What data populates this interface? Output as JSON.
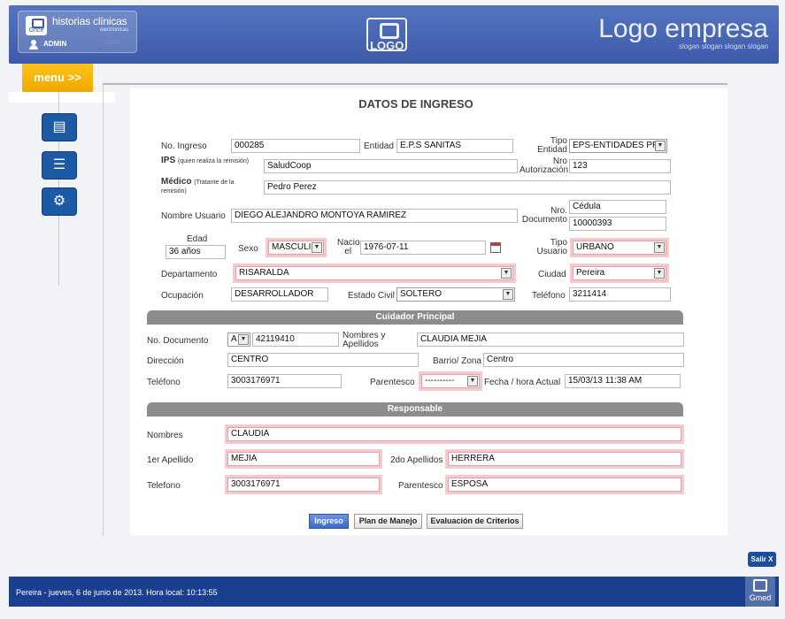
{
  "header": {
    "app_name": "historias clínicas",
    "app_subtitle": "electrónicas",
    "app_logo_text": "Ghce",
    "user_name": "ADMIN",
    "dots": "::::::",
    "brand_logo_text": "LOGO",
    "brand_name": "Logo empresa",
    "brand_slogan": "slogan slogan slogan slogan"
  },
  "menu": {
    "label": "menu >>",
    "icons": [
      "documents-icon",
      "clipboard-icon",
      "gear-icon"
    ]
  },
  "form": {
    "title": "DATOS DE INGRESO",
    "no_ingreso_label": "No. Ingreso",
    "no_ingreso": "000285",
    "entidad_label": "Entidad",
    "entidad": "E.P.S SANITAS",
    "tipo_entidad_label_1": "Tipo",
    "tipo_entidad_label_2": "Entidad",
    "tipo_entidad": "EPS-ENTIDADES PR",
    "ips_label": "IPS",
    "ips_note": "(quien realiza la remisión)",
    "ips": "SaludCoop",
    "nro_autorizacion_label_1": "Nro",
    "nro_autorizacion_label_2": "Autorización",
    "nro_autorizacion": "123",
    "medico_label": "Médico",
    "medico_note": "(Tratante de la remisión)",
    "medico": "Pedro Perez",
    "nombre_usuario_label": "Nombre Usuario",
    "nombre_usuario": "DIEGO ALEJANDRO MONTOYA RAMIREZ",
    "nro_documento_label_1": "Nro.",
    "nro_documento_label_2": "Documento",
    "tipo_documento": "Cédula",
    "nro_documento": "10000393",
    "edad_label": "Edad",
    "edad": "36 años",
    "sexo_label": "Sexo",
    "sexo": "MASCULIN",
    "nacio_label_1": "Nacio",
    "nacio_label_2": "el",
    "fecha_nacimiento": "1976-07-11",
    "tipo_usuario_label_1": "Tipo",
    "tipo_usuario_label_2": "Usuario",
    "tipo_usuario": "URBANO",
    "departamento_label": "Departamento",
    "departamento": "RISARALDA",
    "ciudad_label": "Ciudad",
    "ciudad": "Pereira",
    "ocupacion_label": "Ocupación",
    "ocupacion": "DESARROLLADOR",
    "estado_civil_label": "Estado Civil",
    "estado_civil": "SOLTERO",
    "telefono_label": "Teléfono",
    "telefono": "3211414"
  },
  "cuidador": {
    "section_title": "Cuidador Principal",
    "no_documento_label": "No. Documento",
    "tipo_doc": "A",
    "no_documento": "42119410",
    "nombres_label_1": "Nombres y",
    "nombres_label_2": "Apellidos",
    "nombres": "CLAUDIA MEJIA",
    "direccion_label": "Dirección",
    "direccion": "CENTRO",
    "barrio_label": "Barrio/ Zona",
    "barrio": "Centro",
    "telefono_label": "Teléfono",
    "telefono": "3003176971",
    "parentesco_label": "Parentesco",
    "parentesco": "----------",
    "fecha_label": "Fecha / hora Actual",
    "fecha": "15/03/13 11:38 AM"
  },
  "responsable": {
    "section_title": "Responsable",
    "nombres_label": "Nombres",
    "nombres": "CLAUDIA",
    "apellido1_label": "1er Apellido",
    "apellido1": "MEJIA",
    "apellido2_label": "2do Apellidos",
    "apellido2": "HERRERA",
    "telefono_label": "Telefono",
    "telefono": "3003176971",
    "parentesco_label": "Parentesco",
    "parentesco": "ESPOSA"
  },
  "tabs": {
    "ingreso": "Ingreso",
    "plan": "Plan de Manejo",
    "evaluacion": "Evaluación de Criterios"
  },
  "salir_label": "Salir X",
  "footer": {
    "status": "Pereira - jueves, 6 de junio de 2013. Hora local: 10:13:55",
    "logo": "Gmed"
  }
}
